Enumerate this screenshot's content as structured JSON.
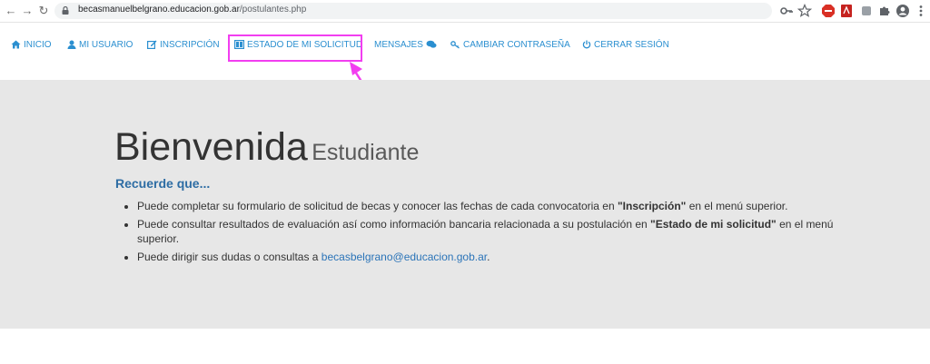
{
  "browser": {
    "url_host": "becasmanuelbelgrano.educacion.gob.ar",
    "url_path": "/postulantes.php"
  },
  "nav": {
    "items": [
      {
        "label": "INICIO",
        "icon": "home-icon"
      },
      {
        "label": "MI USUARIO",
        "icon": "user-icon"
      },
      {
        "label": "INSCRIPCIÓN",
        "icon": "edit-icon"
      },
      {
        "label": "ESTADO DE MI SOLICITUD",
        "icon": "columns-icon"
      },
      {
        "label": "MENSAJES",
        "icon": "chat-icon"
      },
      {
        "label": "CAMBIAR CONTRASEÑA",
        "icon": "key-icon"
      },
      {
        "label": "CERRAR SESIÓN",
        "icon": "power-icon"
      }
    ],
    "color": "#2b8fd0"
  },
  "hero": {
    "title": "Bienvenida",
    "subtitle": "Estudiante",
    "reminder_heading": "Recuerde que...",
    "bullets": {
      "b1_pre": "Puede completar su formulario de solicitud de becas y conocer las fechas de cada convocatoria en ",
      "b1_bold": "\"Inscripción\"",
      "b1_post": " en el menú superior.",
      "b2_pre": "Puede consultar resultados de evaluación así como información bancaria relacionada a su postulación en ",
      "b2_bold": "\"Estado de mi solicitud\"",
      "b2_post": " en el menú superior.",
      "b3_pre": "Puede dirigir sus dudas o consultas a ",
      "b3_link": "becasbelgrano@educacion.gob.ar",
      "b3_post": "."
    }
  },
  "annotation": {
    "highlight_color": "#f23ef0"
  }
}
